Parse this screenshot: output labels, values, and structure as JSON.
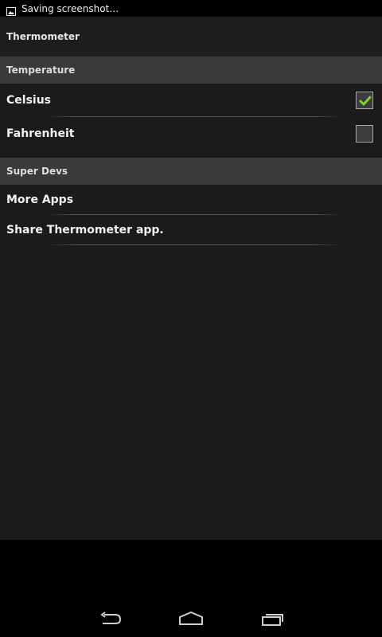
{
  "status_bar": {
    "notification_icon": "image-icon",
    "text": "Saving screenshot…"
  },
  "app": {
    "title": "Thermometer"
  },
  "sections": [
    {
      "header": "Temperature",
      "items": [
        {
          "label": "Celsius",
          "checked": true
        },
        {
          "label": "Fahrenheit",
          "checked": false
        }
      ]
    },
    {
      "header": "Super Devs",
      "items": [
        {
          "label": "More Apps"
        },
        {
          "label": "Share Thermometer app."
        }
      ]
    }
  ],
  "nav": {
    "back_icon": "back-icon",
    "home_icon": "home-icon",
    "recents_icon": "recents-icon"
  },
  "colors": {
    "check_green": "#7ed12f",
    "header_bg": "#3a3a3a",
    "app_bg": "#1b1b1b"
  }
}
